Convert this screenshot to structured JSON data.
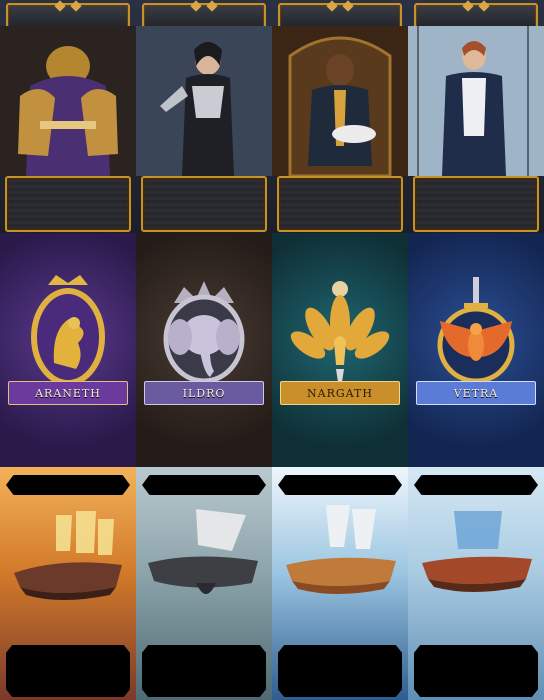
{
  "characters": [
    {
      "icon": "samurai-portrait"
    },
    {
      "icon": "duelist-portrait"
    },
    {
      "icon": "merchant-portrait"
    },
    {
      "icon": "naval-officer-portrait"
    }
  ],
  "crests": [
    {
      "name": "ARANETH",
      "icon": "lion-crest-icon",
      "accent": "#6b3fa0",
      "banner": "#6a3b9c"
    },
    {
      "name": "ILDRO",
      "icon": "elephant-crest-icon",
      "accent": "#3b302b",
      "banner": "#6a5aa0"
    },
    {
      "name": "NARGATH",
      "icon": "peacock-crest-icon",
      "accent": "#1f5a63",
      "banner": "#c98f2b"
    },
    {
      "name": "VETRA",
      "icon": "phoenix-crest-icon",
      "accent": "#1e3f7a",
      "banner": "#5a7bd6"
    }
  ],
  "airships": [
    {
      "icon": "golden-airship-icon"
    },
    {
      "icon": "steel-airship-icon"
    },
    {
      "icon": "copper-airship-icon"
    },
    {
      "icon": "blue-sail-airship-icon"
    }
  ]
}
